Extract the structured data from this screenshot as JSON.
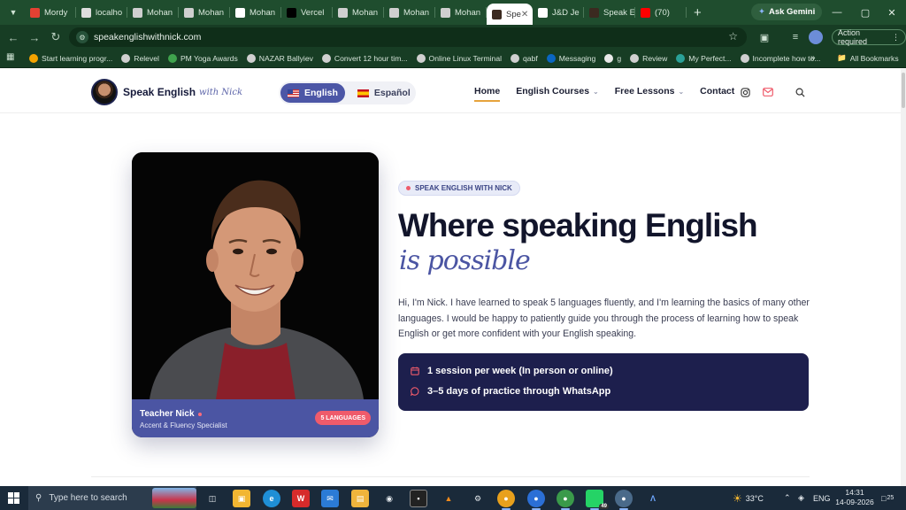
{
  "browser": {
    "tabs": [
      {
        "title": "Mordy",
        "color": "#e34133"
      },
      {
        "title": "localho",
        "color": "#dddddd"
      },
      {
        "title": "Mohan",
        "color": "#cfcfcf"
      },
      {
        "title": "Mohan",
        "color": "#cfcfcf"
      },
      {
        "title": "Mohan",
        "color": "#ffffff"
      },
      {
        "title": "Vercel",
        "color": "#000000"
      },
      {
        "title": "Mohan",
        "color": "#cfcfcf"
      },
      {
        "title": "Mohan",
        "color": "#cfcfcf"
      },
      {
        "title": "Mohan",
        "color": "#cfcfcf"
      },
      {
        "title": "Spe",
        "color": "#3b2a20",
        "active": true
      },
      {
        "title": "J&D Je",
        "color": "#ffffff"
      },
      {
        "title": "Speak E",
        "color": "#3b2a20"
      },
      {
        "title": "(70)",
        "color": "#ff0000"
      }
    ],
    "gemini_label": "Ask Gemini",
    "url": "speakenglishwithnick.com",
    "action_required": "Action required",
    "bookmarks": [
      {
        "label": "Start learning progr...",
        "color": "#f4a300"
      },
      {
        "label": "Relevel",
        "color": "#d0d0d0"
      },
      {
        "label": "PM Yoga Awards",
        "color": "#3fa34d"
      },
      {
        "label": "NAZAR Ballyiev",
        "color": "#d0d0d0"
      },
      {
        "label": "Convert 12 hour tim...",
        "color": "#d0d0d0"
      },
      {
        "label": "Online Linux Terminal",
        "color": "#d0d0d0"
      },
      {
        "label": "qabf",
        "color": "#d0d0d0"
      },
      {
        "label": "Messaging",
        "color": "#0a66c2"
      },
      {
        "label": "g",
        "color": "#e9e9e9"
      },
      {
        "label": "Review",
        "color": "#d0d0d0"
      },
      {
        "label": "My Perfect...",
        "color": "#2aa198"
      },
      {
        "label": "Incomplete how to...",
        "color": "#d0d0d0"
      }
    ],
    "all_bookmarks": "All Bookmarks"
  },
  "site": {
    "logo_text": "Speak English",
    "logo_sub": "with Nick",
    "lang_en": "English",
    "lang_es": "Español",
    "nav": [
      "Home",
      "English Courses",
      "Free Lessons",
      "Contact"
    ],
    "accent": "#4b55a3",
    "eyebrow": "SPEAK ENGLISH WITH NICK",
    "headline": "Where speaking English",
    "headline_sub": "is possible",
    "intro": "Hi, I'm Nick. I have learned to speak 5 languages fluently, and I'm learning the basics of many other languages. I would be happy to patiently guide you through the process of learning how to speak English or get more confident with your English speaking.",
    "features": [
      {
        "icon": "calendar-icon",
        "text": "1 session per week (In person or online)"
      },
      {
        "icon": "chat-icon",
        "text": "3–5 days of practice through WhatsApp"
      }
    ],
    "teacher_name": "Teacher Nick",
    "teacher_role": "Accent & Fluency Specialist",
    "languages_badge": "5 LANGUAGES"
  },
  "taskbar": {
    "search_placeholder": "Type here to search",
    "weather": "33°C",
    "lang": "ENG",
    "time": "14:31",
    "date": "14-09-2026",
    "notifications": "25",
    "whatsapp_badge": "49"
  }
}
